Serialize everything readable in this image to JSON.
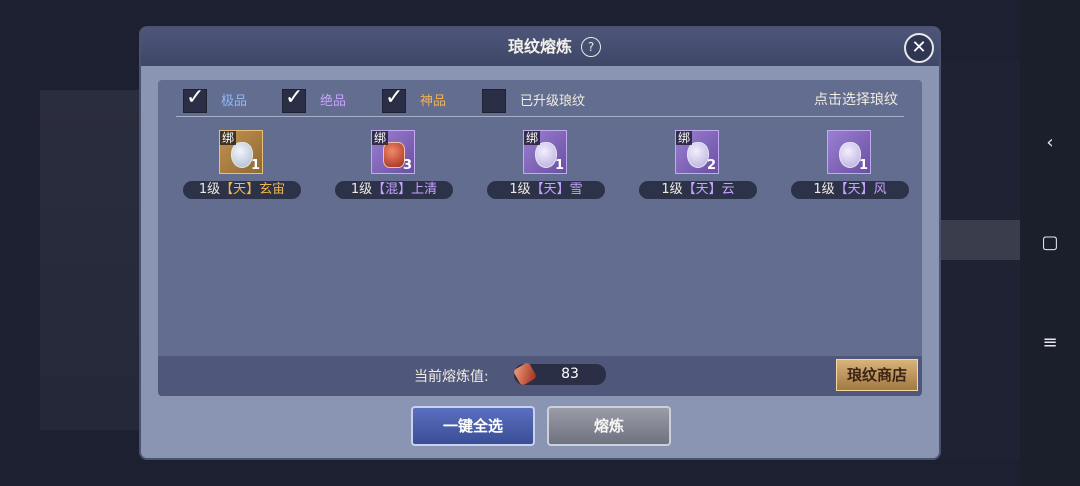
{
  "dialog": {
    "title": "琅纹熔炼",
    "help_glyph": "?",
    "close_glyph": "✕"
  },
  "filters": [
    {
      "label": "极品",
      "checked": true,
      "color": "#8fb8ff"
    },
    {
      "label": "绝品",
      "checked": true,
      "color": "#c6a3ff"
    },
    {
      "label": "神品",
      "checked": true,
      "color": "#f0b25a"
    },
    {
      "label": "已升级琅纹",
      "checked": false,
      "color": "#f0ece2"
    }
  ],
  "hint": "点击选择琅纹",
  "items": [
    {
      "bind": "绑",
      "qty": "1",
      "level": "1级",
      "tier": "【天】",
      "name": "玄宙",
      "frame": "gold",
      "name_color": "#f2b64f",
      "bound": true
    },
    {
      "bind": "绑",
      "qty": "3",
      "level": "1级",
      "tier": "【混】",
      "name": "上清",
      "frame": "purple",
      "name_color": "#c6a3ff",
      "bound": true
    },
    {
      "bind": "绑",
      "qty": "1",
      "level": "1级",
      "tier": "【天】",
      "name": "雪",
      "frame": "purple",
      "name_color": "#c6a3ff",
      "bound": true
    },
    {
      "bind": "绑",
      "qty": "2",
      "level": "1级",
      "tier": "【天】",
      "name": "云",
      "frame": "purple",
      "name_color": "#c6a3ff",
      "bound": true
    },
    {
      "bind": "",
      "qty": "1",
      "level": "1级",
      "tier": "【天】",
      "name": "风",
      "frame": "purple",
      "name_color": "#c6a3ff",
      "bound": false
    }
  ],
  "footer": {
    "smelt_label": "当前熔炼值:",
    "smelt_value": "83",
    "shop_label": "琅纹商店"
  },
  "buttons": {
    "select_all": "一键全选",
    "smelt": "熔炼"
  },
  "nav": {
    "back": "‹",
    "home": "▢",
    "menu": "≡"
  }
}
